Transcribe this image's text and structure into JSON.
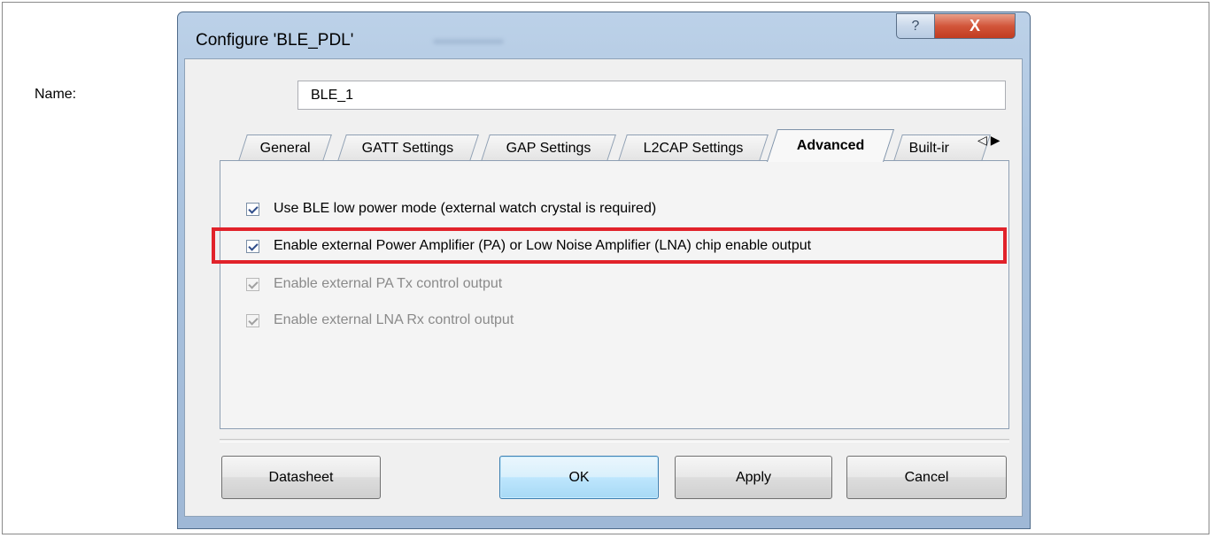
{
  "window": {
    "title": "Configure 'BLE_PDL'",
    "help_glyph": "?",
    "close_glyph": "X"
  },
  "name_field": {
    "label": "Name:",
    "value": "BLE_1"
  },
  "tabs": [
    {
      "label": "General",
      "active": false
    },
    {
      "label": "GATT Settings",
      "active": false
    },
    {
      "label": "GAP Settings",
      "active": false
    },
    {
      "label": "L2CAP Settings",
      "active": false
    },
    {
      "label": "Advanced",
      "active": true
    },
    {
      "label": "Built-ir",
      "active": false
    }
  ],
  "tab_scroll": {
    "left": "◁",
    "right": "▶"
  },
  "options": [
    {
      "label": "Use BLE low power mode (external watch crystal is required)",
      "checked": true,
      "enabled": true
    },
    {
      "label": "Enable external Power Amplifier (PA) or Low Noise Amplifier (LNA) chip enable output",
      "checked": true,
      "enabled": true,
      "highlighted": true
    },
    {
      "label": "Enable external PA Tx control output",
      "checked": true,
      "enabled": false
    },
    {
      "label": "Enable external LNA Rx control output",
      "checked": true,
      "enabled": false
    }
  ],
  "buttons": {
    "datasheet": "Datasheet",
    "ok": "OK",
    "apply": "Apply",
    "cancel": "Cancel"
  },
  "colors": {
    "highlight": "#e1222a",
    "close_button": "#c13c20",
    "default_button": "#3c7fb1"
  }
}
